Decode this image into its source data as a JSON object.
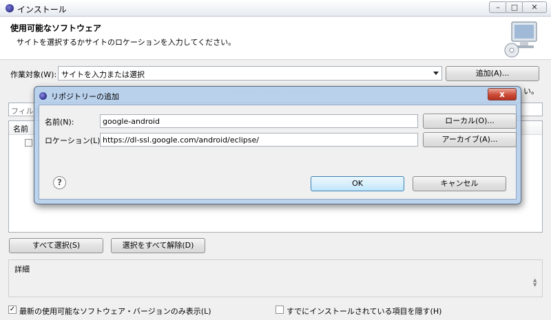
{
  "window": {
    "title": "インストール",
    "controls": [
      "–",
      "□",
      "✕"
    ]
  },
  "header": {
    "title": "使用可能なソフトウェア",
    "description": "サイトを選択するかサイトのロケーションを入力してください。"
  },
  "work_with": {
    "label": "作業対象(W):",
    "value": "サイトを入力または選択",
    "add_button": "追加(A)..."
  },
  "filter": {
    "placeholder": "フィルタ"
  },
  "tree": {
    "column_name": "名前"
  },
  "actions": {
    "select_all": "すべて選択(S)",
    "deselect_all": "選択をすべて解除(D)"
  },
  "details": {
    "label": "詳細"
  },
  "options": {
    "show_latest": {
      "label": "最新の使用可能なソフトウェア・バージョンのみ表示(L)",
      "checked": true
    },
    "hide_installed": {
      "label": "すでにインストールされている項目を隠す(H)",
      "checked": false
    }
  },
  "background_fragment": "い。",
  "dialog": {
    "title": "リポジトリーの追加",
    "name_label": "名前(N):",
    "name_value": "google-android",
    "location_label": "ロケーション(L):",
    "location_value": "https://dl-ssl.google.com/android/eclipse/",
    "local_button": "ローカル(O)...",
    "archive_button": "アーカイブ(A)...",
    "ok_button": "OK",
    "cancel_button": "キャンセル",
    "close_glyph": "x",
    "help_glyph": "?"
  }
}
